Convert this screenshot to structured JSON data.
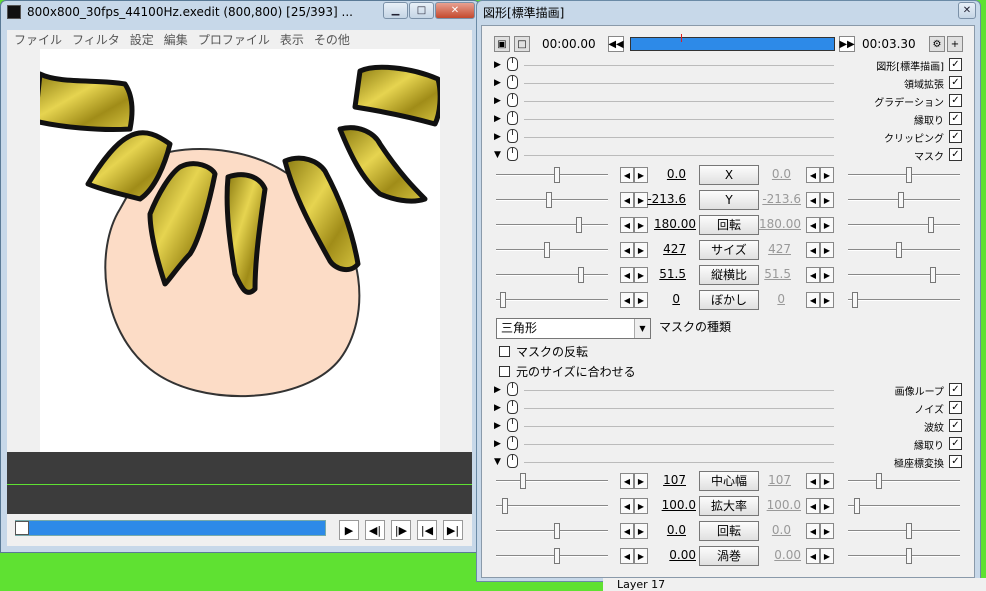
{
  "main_window": {
    "title": "800x800_30fps_44100Hz.exedit (800,800)  [25/393]  ...",
    "menu": [
      "ファイル",
      "フィルタ",
      "設定",
      "編集",
      "プロファイル",
      "表示",
      "その他"
    ]
  },
  "panel": {
    "title": "図形[標準描画]",
    "time_start": "00:00.00",
    "time_end": "00:03.30",
    "effects_top": [
      {
        "label": "図形[標準描画]",
        "checked": true
      },
      {
        "label": "領域拡張",
        "checked": true
      },
      {
        "label": "グラデーション",
        "checked": true
      },
      {
        "label": "縁取り",
        "checked": true
      },
      {
        "label": "クリッピング",
        "checked": true
      },
      {
        "label": "マスク",
        "checked": true
      }
    ],
    "mask_params": [
      {
        "left": "0.0",
        "name": "X",
        "right": "0.0"
      },
      {
        "left": "-213.6",
        "name": "Y",
        "right": "-213.6"
      },
      {
        "left": "180.00",
        "name": "回転",
        "right": "180.00"
      },
      {
        "left": "427",
        "name": "サイズ",
        "right": "427"
      },
      {
        "left": "51.5",
        "name": "縦横比",
        "right": "51.5"
      },
      {
        "left": "0",
        "name": "ぼかし",
        "right": "0"
      }
    ],
    "mask_type_value": "三角形",
    "mask_type_label": "マスクの種類",
    "invert_label": "マスクの反転",
    "fit_label": "元のサイズに合わせる",
    "effects_bottom": [
      {
        "label": "画像ループ",
        "checked": true
      },
      {
        "label": "ノイズ",
        "checked": true
      },
      {
        "label": "波紋",
        "checked": true
      },
      {
        "label": "縁取り",
        "checked": true
      },
      {
        "label": "極座標変換",
        "checked": true
      }
    ],
    "polar_params": [
      {
        "left": "107",
        "name": "中心幅",
        "right": "107"
      },
      {
        "left": "100.0",
        "name": "拡大率",
        "right": "100.0"
      },
      {
        "left": "0.0",
        "name": "回転",
        "right": "0.0"
      },
      {
        "left": "0.00",
        "name": "渦巻",
        "right": "0.00"
      }
    ]
  },
  "background": {
    "layer_label": "Layer 17"
  },
  "colors": {
    "accent": "#2d8ae8",
    "desktop": "#5fe132"
  }
}
